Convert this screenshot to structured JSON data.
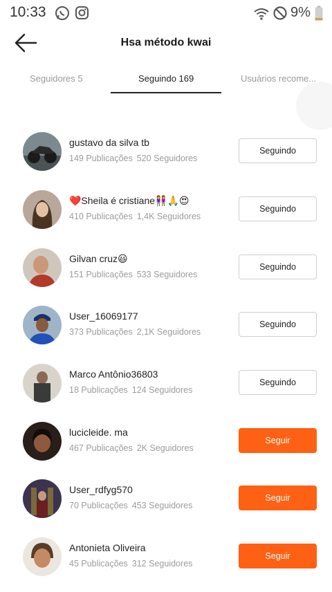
{
  "status_bar": {
    "time": "10:33",
    "battery": "9%"
  },
  "header": {
    "title": "Hsa método kwai"
  },
  "tabs": [
    {
      "label": "Seguidores 5"
    },
    {
      "label": "Seguindo 169"
    },
    {
      "label": "Usuários recome..."
    }
  ],
  "users": [
    {
      "name": "gustavo da silva tb",
      "posts": "149 Publicações",
      "followers": "520 Seguidores",
      "button": "Seguindo",
      "following": true
    },
    {
      "name": "❤️Sheila é cristiane👭🙏😍",
      "posts": "410 Publicações",
      "followers": "1,4K Seguidores",
      "button": "Seguindo",
      "following": true
    },
    {
      "name": "Gilvan cruz😃",
      "posts": "151 Publicações",
      "followers": "533 Seguidores",
      "button": "Seguindo",
      "following": true
    },
    {
      "name": "User_16069177",
      "posts": "373 Publicações",
      "followers": "2,1K Seguidores",
      "button": "Seguindo",
      "following": true
    },
    {
      "name": "Marco Antônio36803",
      "posts": "18 Publicações",
      "followers": "124 Seguidores",
      "button": "Seguindo",
      "following": true
    },
    {
      "name": "lucicleide. ma",
      "posts": "467 Publicações",
      "followers": "2K Seguidores",
      "button": "Seguir",
      "following": false
    },
    {
      "name": "User_rdfyg570",
      "posts": "70 Publicações",
      "followers": "453 Seguidores",
      "button": "Seguir",
      "following": false
    },
    {
      "name": "Antonieta Oliveira",
      "posts": "45 Publicações",
      "followers": "312 Seguidores",
      "button": "Seguir",
      "following": false
    }
  ],
  "colors": {
    "accent": "#fe6113",
    "active_tab": "#222222",
    "muted_text": "#9c9c9c"
  }
}
